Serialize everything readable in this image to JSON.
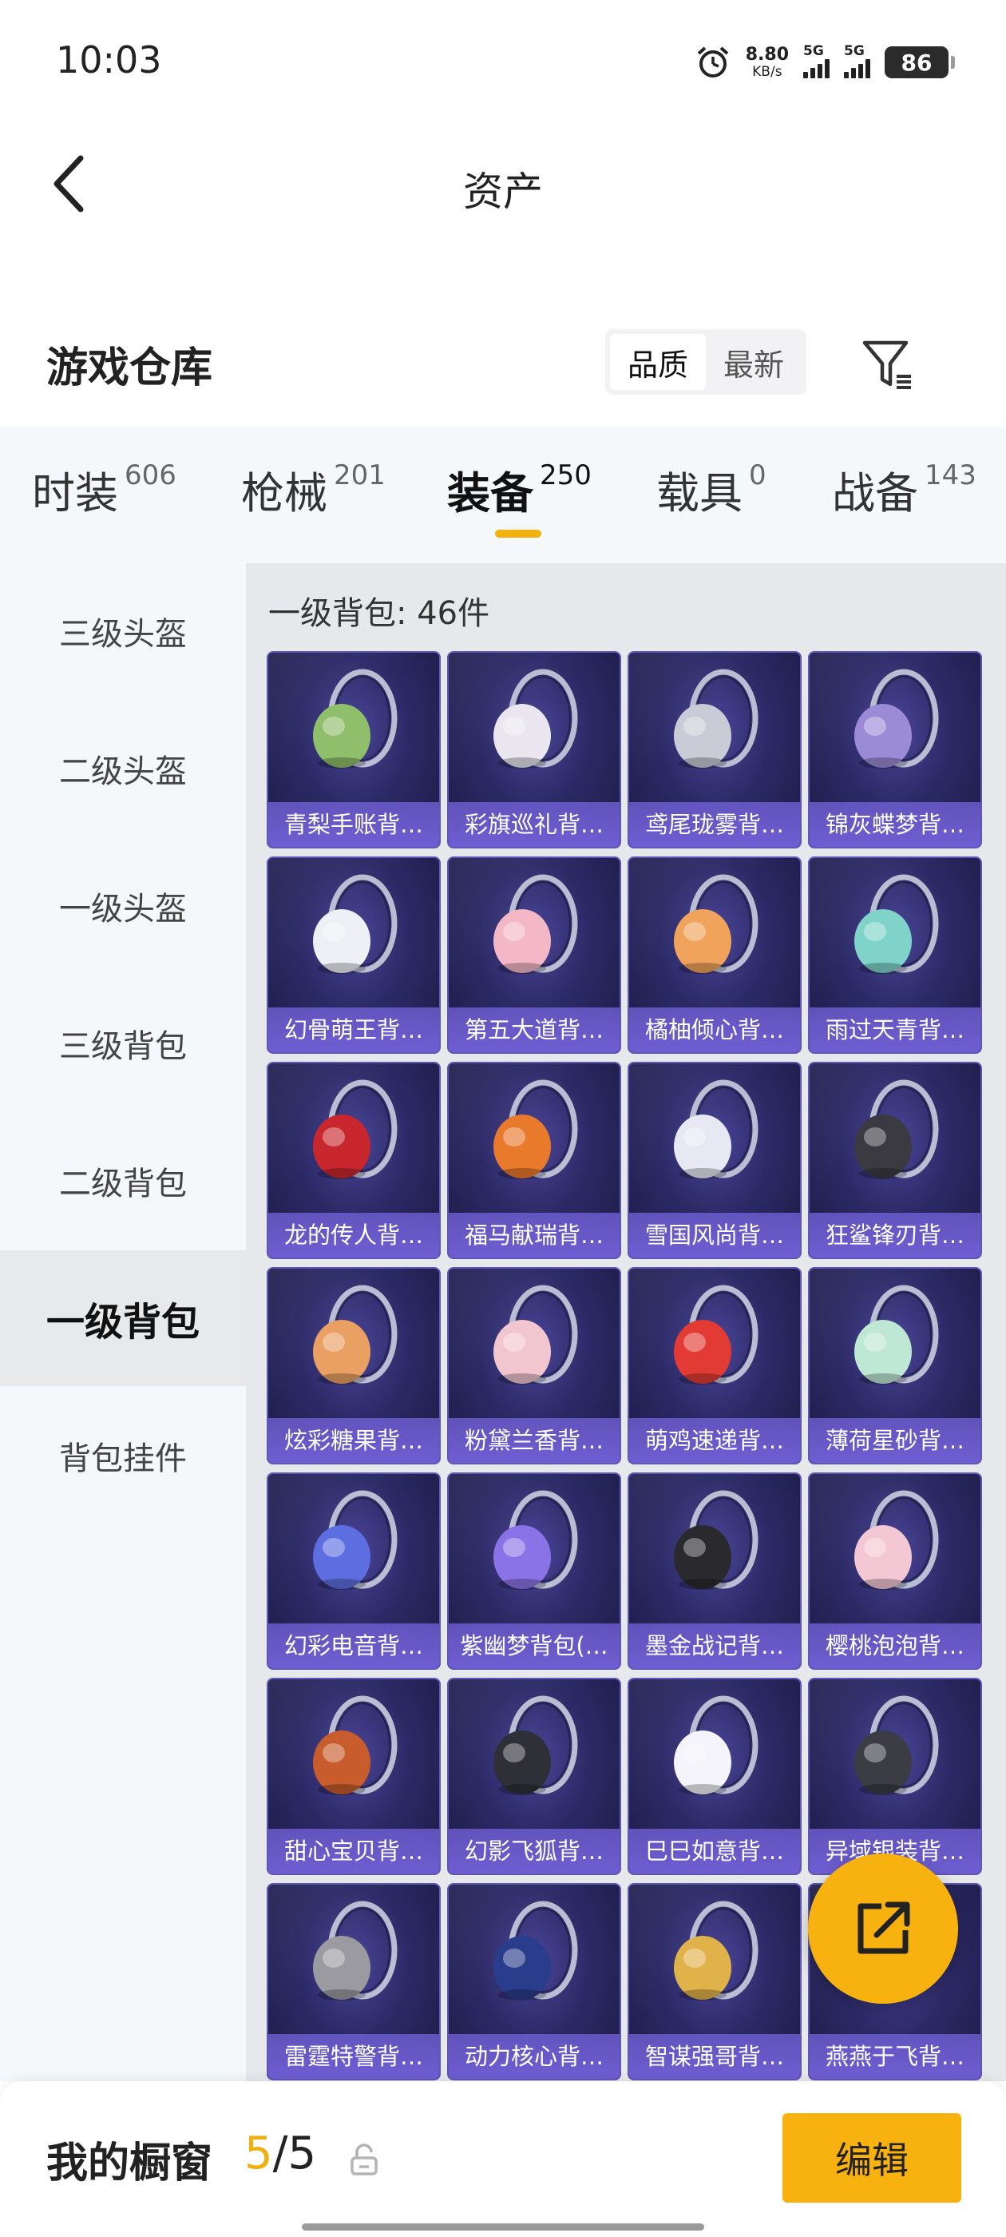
{
  "status_bar": {
    "time": "10:03",
    "net_speed": "8.80",
    "net_unit": "KB/s",
    "signal1": "5G",
    "signal2": "5G",
    "battery": "86"
  },
  "header": {
    "title": "资产"
  },
  "section": {
    "title": "游戏仓库",
    "sort_options": [
      "品质",
      "最新"
    ],
    "active_sort": "品质"
  },
  "tabs": [
    {
      "label": "时装",
      "count": "606"
    },
    {
      "label": "枪械",
      "count": "201"
    },
    {
      "label": "装备",
      "count": "250"
    },
    {
      "label": "载具",
      "count": "0"
    },
    {
      "label": "战备",
      "count": "143"
    }
  ],
  "active_tab": "装备",
  "sidebar": {
    "items": [
      {
        "label": "三级头盔"
      },
      {
        "label": "二级头盔"
      },
      {
        "label": "一级头盔"
      },
      {
        "label": "三级背包"
      },
      {
        "label": "二级背包"
      },
      {
        "label": "一级背包"
      },
      {
        "label": "背包挂件"
      }
    ],
    "active": "一级背包"
  },
  "panel": {
    "caption": "一级背包: 46件",
    "items": [
      {
        "name": "青梨手账背…",
        "icon": "matcha-roll-backpack-icon",
        "color": "#8fbf6a"
      },
      {
        "name": "彩旗巡礼背…",
        "icon": "flag-backpack-icon",
        "color": "#e9e6ef"
      },
      {
        "name": "鸢尾珑雾背…",
        "icon": "iris-backpack-icon",
        "color": "#c9ccd6"
      },
      {
        "name": "锦灰蝶梦背…",
        "icon": "butterfly-backpack-icon",
        "color": "#9b8ad6"
      },
      {
        "name": "幻骨萌王背…",
        "icon": "ghost-backpack-icon",
        "color": "#eef0f6"
      },
      {
        "name": "第五大道背…",
        "icon": "quilted-backpack-icon",
        "color": "#f3b7c6"
      },
      {
        "name": "橘柚倾心背…",
        "icon": "citrus-backpack-icon",
        "color": "#f0a35a"
      },
      {
        "name": "雨过天青背…",
        "icon": "celadon-backpack-icon",
        "color": "#7fd3c9"
      },
      {
        "name": "龙的传人背…",
        "icon": "dragon-backpack-icon",
        "color": "#c8282d"
      },
      {
        "name": "福马献瑞背…",
        "icon": "horse-backpack-icon",
        "color": "#e9792b"
      },
      {
        "name": "雪国风尚背…",
        "icon": "snow-backpack-icon",
        "color": "#e8e8f4"
      },
      {
        "name": "狂鲨锋刃背…",
        "icon": "shark-backpack-icon",
        "color": "#3a3a40"
      },
      {
        "name": "炫彩糖果背…",
        "icon": "donut-backpack-icon",
        "color": "#e9a062"
      },
      {
        "name": "粉黛兰香背…",
        "icon": "pink-round-backpack-icon",
        "color": "#f1c6cf"
      },
      {
        "name": "萌鸡速递背…",
        "icon": "chick-backpack-icon",
        "color": "#e23b33"
      },
      {
        "name": "薄荷星砂背…",
        "icon": "mint-backpack-icon",
        "color": "#bfe8d4"
      },
      {
        "name": "幻彩电音背…",
        "icon": "speaker-backpack-icon",
        "color": "#5d6fe0"
      },
      {
        "name": "紫幽梦背包(…",
        "icon": "purple-orb-backpack-icon",
        "color": "#8a73e6"
      },
      {
        "name": "墨金战记背…",
        "icon": "ink-gold-backpack-icon",
        "color": "#2a2a2e"
      },
      {
        "name": "樱桃泡泡背…",
        "icon": "cherry-bow-backpack-icon",
        "color": "#f3c7d3"
      },
      {
        "name": "甜心宝贝背…",
        "icon": "cupcake-backpack-icon",
        "color": "#c85c2c"
      },
      {
        "name": "幻影飞狐背…",
        "icon": "fox-backpack-icon",
        "color": "#2f2f38"
      },
      {
        "name": "巳巳如意背…",
        "icon": "snake-backpack-icon",
        "color": "#f4f4fa"
      },
      {
        "name": "异域银装背…",
        "icon": "exotic-backpack-icon",
        "color": "#3b3c44"
      },
      {
        "name": "雷霆特警背…",
        "icon": "swat-backpack-icon",
        "color": "#9a9aa0"
      },
      {
        "name": "动力核心背…",
        "icon": "core-backpack-icon",
        "color": "#2a3d8c"
      },
      {
        "name": "智谋强哥背…",
        "icon": "mascot-backpack-icon",
        "color": "#e0b24a"
      },
      {
        "name": "燕燕于飞背…",
        "icon": "swallow-backpack-icon",
        "color": "#5a5e66"
      }
    ]
  },
  "bottom_bar": {
    "label": "我的橱窗",
    "current": "5",
    "separator": "/",
    "total": "5",
    "edit_label": "编辑"
  },
  "colors": {
    "accent": "#f7b20f",
    "card_bg": "#2c2a66",
    "card_label": "#6f5ed2"
  }
}
